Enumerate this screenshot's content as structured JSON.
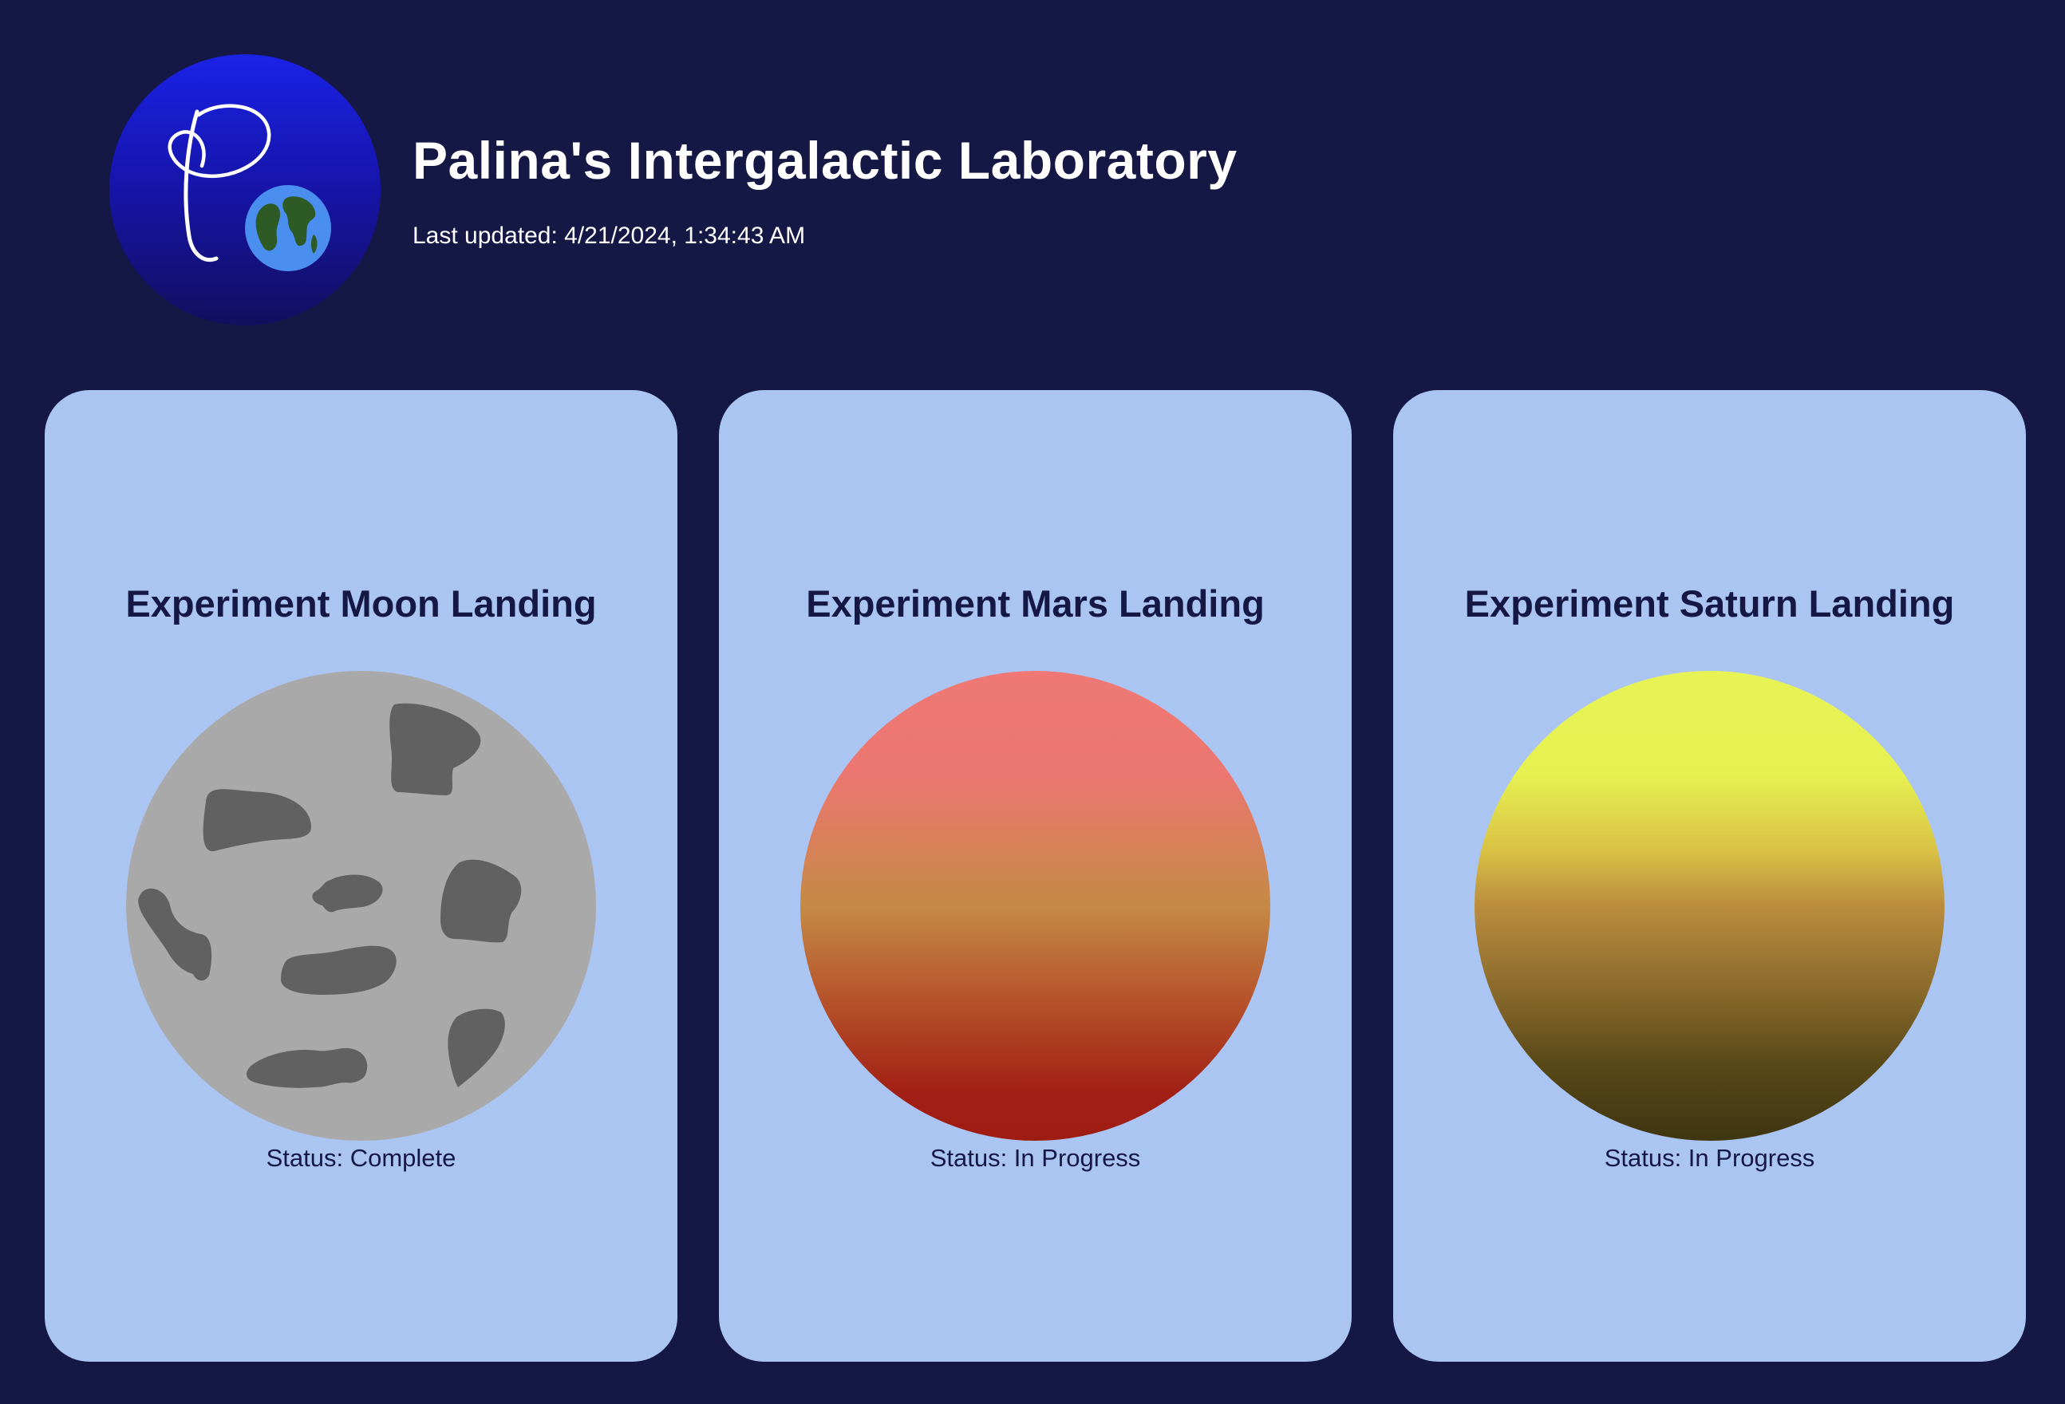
{
  "header": {
    "logo_icon": "lab-logo-icon",
    "title": "Palina's Intergalactic Laboratory",
    "last_updated": "Last updated: 4/21/2024, 1:34:43 AM"
  },
  "experiments": [
    {
      "title": "Experiment Moon Landing",
      "planet_icon": "moon-icon",
      "status": "Status: Complete"
    },
    {
      "title": "Experiment Mars Landing",
      "planet_icon": "mars-icon",
      "status": "Status: In Progress"
    },
    {
      "title": "Experiment Saturn Landing",
      "planet_icon": "saturn-icon",
      "status": "Status: In Progress"
    }
  ],
  "colors": {
    "background": "#151745",
    "card": "#abc5f3",
    "card_text": "#151745",
    "moon": "#a9a9a9",
    "moon_craters": "#616161"
  }
}
